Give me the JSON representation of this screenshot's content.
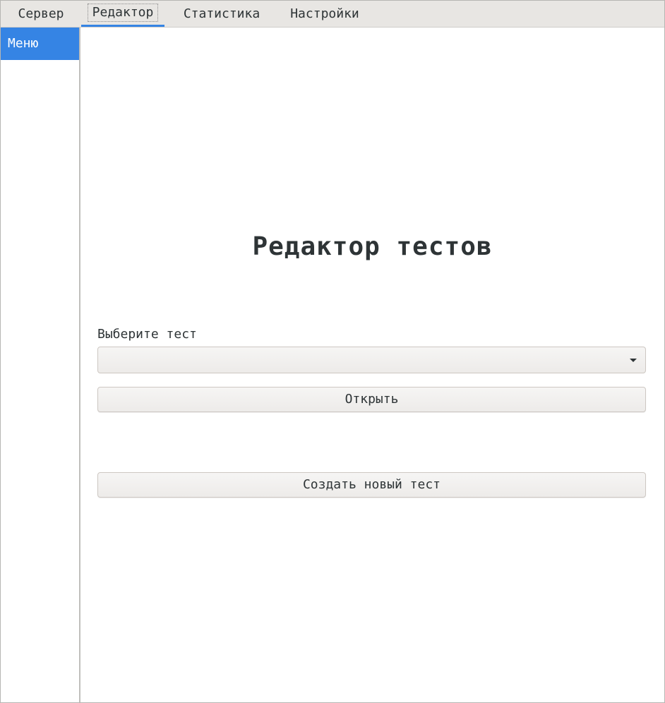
{
  "tabs": [
    {
      "label": "Сервер"
    },
    {
      "label": "Редактор",
      "active": true
    },
    {
      "label": "Статистика"
    },
    {
      "label": "Настройки"
    }
  ],
  "sidebar": {
    "items": [
      {
        "label": "Меню",
        "selected": true
      }
    ]
  },
  "main": {
    "title": "Редактор тестов",
    "select_label": "Выберите тест",
    "select_value": "",
    "open_label": "Открыть",
    "create_label": "Создать новый тест"
  },
  "colors": {
    "accent": "#3584e4",
    "tabbar_bg": "#e8e6e3"
  },
  "icons": {
    "combo_arrow": "chevron-down-icon"
  }
}
